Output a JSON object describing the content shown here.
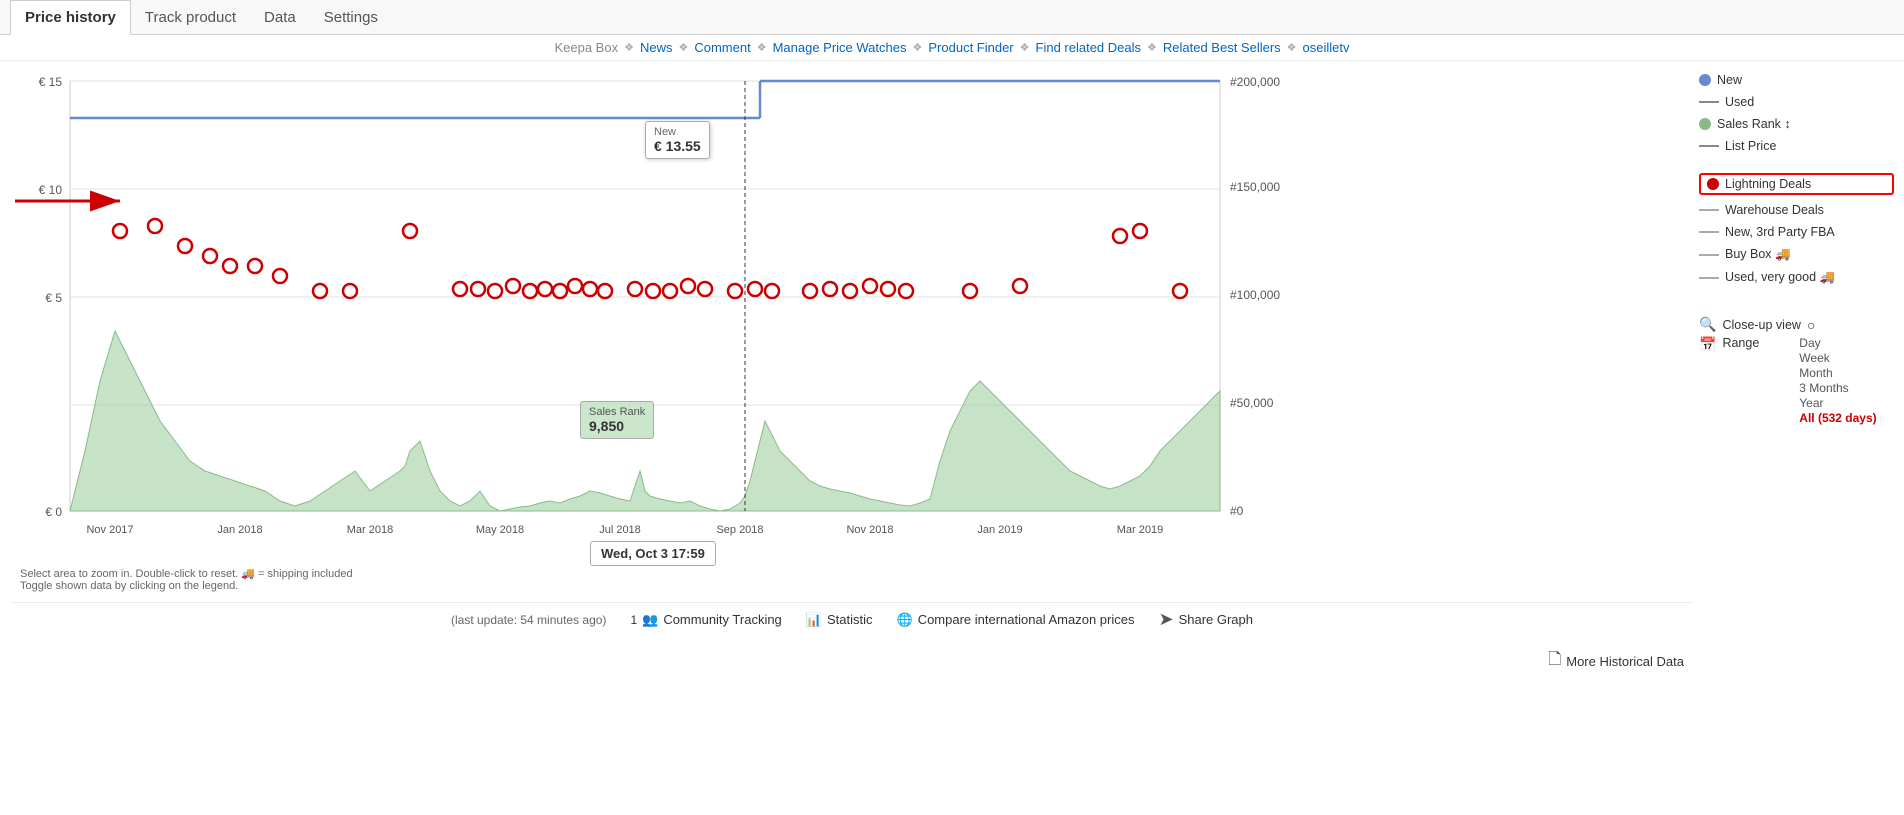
{
  "tabs": [
    {
      "label": "Price history",
      "active": true
    },
    {
      "label": "Track product",
      "active": false
    },
    {
      "label": "Data",
      "active": false
    },
    {
      "label": "Settings",
      "active": false
    }
  ],
  "nav": {
    "brand": "Keepa Box",
    "links": [
      {
        "label": "News"
      },
      {
        "label": "Comment"
      },
      {
        "label": "Manage Price Watches"
      },
      {
        "label": "Product Finder"
      },
      {
        "label": "Find related Deals"
      },
      {
        "label": "Related Best Sellers"
      },
      {
        "label": "oseilletv"
      }
    ]
  },
  "chart": {
    "y_labels": [
      "€ 15",
      "€ 10",
      "€ 5",
      "€ 0"
    ],
    "y_right_labels": [
      "#200,000",
      "#150,000",
      "#100,000",
      "#50,000",
      "#0"
    ],
    "x_labels": [
      "Nov 2017",
      "Jan 2018",
      "Mar 2018",
      "May 2018",
      "Jul 201...",
      "Sep 2018",
      "Nov 2018",
      "Jan 2019",
      "Mar 2019"
    ],
    "tooltip_new": {
      "title": "New",
      "value": "€ 13.55"
    },
    "tooltip_salesrank": {
      "label": "Sales Rank",
      "value": "9,850"
    },
    "tooltip_datetime": "Wed, Oct 3 17:59"
  },
  "legend": {
    "items": [
      {
        "type": "dot",
        "color": "#6688cc",
        "label": "New"
      },
      {
        "type": "line",
        "color": "#888",
        "label": "Used"
      },
      {
        "type": "dot",
        "color": "#88bb88",
        "label": "Sales Rank ↕"
      },
      {
        "type": "line",
        "color": "#888",
        "label": "List Price"
      },
      {
        "type": "lightning",
        "color": "#cc0000",
        "label": "Lightning Deals"
      },
      {
        "type": "line",
        "color": "#aaa",
        "label": "Warehouse Deals"
      },
      {
        "type": "line",
        "color": "#aaa",
        "label": "New, 3rd Party FBA"
      },
      {
        "type": "line",
        "color": "#aaa",
        "label": "Buy Box 🚚"
      },
      {
        "type": "line",
        "color": "#aaa",
        "label": "Used, very good 🚚"
      }
    ]
  },
  "controls": {
    "close_up_view": "Close-up view",
    "range_label": "Range",
    "range_options": [
      {
        "label": "Day"
      },
      {
        "label": "Week"
      },
      {
        "label": "Month"
      },
      {
        "label": "3 Months"
      },
      {
        "label": "Year"
      },
      {
        "label": "All (532 days)",
        "active": true
      }
    ]
  },
  "bottom": {
    "instructions": "Select area to zoom in. Double-click to reset.   🚚 = shipping included\nToggle shown data by clicking on the legend.",
    "last_update": "(last update: 54 minutes ago)",
    "actions": [
      {
        "icon": "👥",
        "label": "Community Tracking",
        "count": "1"
      },
      {
        "icon": "📊",
        "label": "Statistic"
      },
      {
        "icon": "🌐",
        "label": "Compare international Amazon prices"
      },
      {
        "icon": "↗",
        "label": "Share Graph"
      }
    ],
    "more_historical": "More Historical Data"
  }
}
